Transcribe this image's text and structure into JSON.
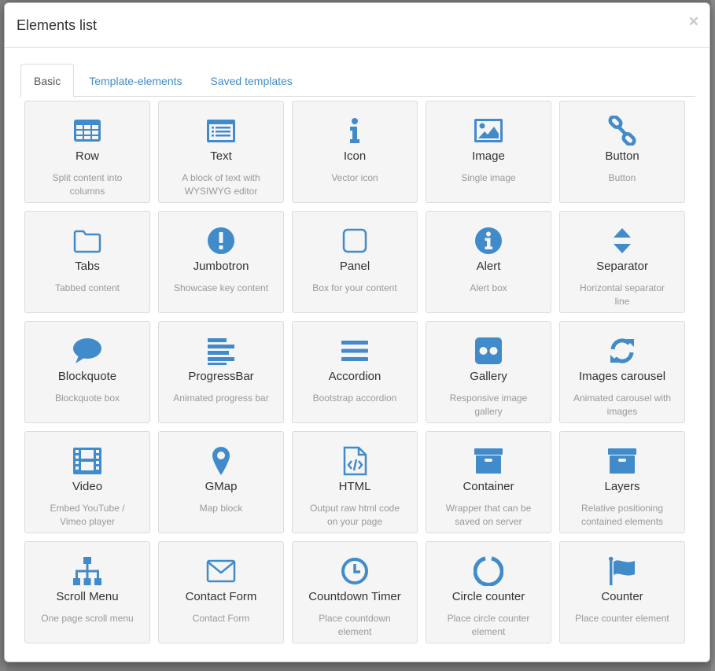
{
  "modal": {
    "title": "Elements list",
    "close_label": "×"
  },
  "tabs": [
    {
      "label": "Basic",
      "active": true
    },
    {
      "label": "Template-elements",
      "active": false
    },
    {
      "label": "Saved templates",
      "active": false
    }
  ],
  "colors": {
    "icon": "#428bca",
    "tab_link": "#428bca"
  },
  "elements": [
    {
      "title": "Row",
      "desc": "Split content into columns",
      "icon": "table-icon"
    },
    {
      "title": "Text",
      "desc": "A block of text with WYSIWYG editor",
      "icon": "text-block-icon"
    },
    {
      "title": "Icon",
      "desc": "Vector icon",
      "icon": "info-icon"
    },
    {
      "title": "Image",
      "desc": "Single image",
      "icon": "image-icon"
    },
    {
      "title": "Button",
      "desc": "Button",
      "icon": "link-icon"
    },
    {
      "title": "Tabs",
      "desc": "Tabbed content",
      "icon": "folder-icon"
    },
    {
      "title": "Jumbotron",
      "desc": "Showcase key content",
      "icon": "exclamation-circle-icon"
    },
    {
      "title": "Panel",
      "desc": "Box for your content",
      "icon": "square-icon"
    },
    {
      "title": "Alert",
      "desc": "Alert box",
      "icon": "info-circle-icon"
    },
    {
      "title": "Separator",
      "desc": "Horizontal separator line",
      "icon": "sort-icon"
    },
    {
      "title": "Blockquote",
      "desc": "Blockquote box",
      "icon": "comment-icon"
    },
    {
      "title": "ProgressBar",
      "desc": "Animated progress bar",
      "icon": "align-left-icon"
    },
    {
      "title": "Accordion",
      "desc": "Bootstrap accordion",
      "icon": "bars-icon"
    },
    {
      "title": "Gallery",
      "desc": "Responsive image gallery",
      "icon": "flickr-icon"
    },
    {
      "title": "Images carousel",
      "desc": "Animated carousel with images",
      "icon": "refresh-icon"
    },
    {
      "title": "Video",
      "desc": "Embed YouTube / Vimeo player",
      "icon": "film-icon"
    },
    {
      "title": "GMap",
      "desc": "Map block",
      "icon": "map-marker-icon"
    },
    {
      "title": "HTML",
      "desc": "Output raw html code on your page",
      "icon": "file-code-icon"
    },
    {
      "title": "Container",
      "desc": "Wrapper that can be saved on server",
      "icon": "archive-icon"
    },
    {
      "title": "Layers",
      "desc": "Relative positioning contained elements",
      "icon": "archive-icon"
    },
    {
      "title": "Scroll Menu",
      "desc": "One page scroll menu",
      "icon": "sitemap-icon"
    },
    {
      "title": "Contact Form",
      "desc": "Contact Form",
      "icon": "envelope-icon"
    },
    {
      "title": "Countdown Timer",
      "desc": "Place countdown element",
      "icon": "clock-icon"
    },
    {
      "title": "Circle counter",
      "desc": "Place circle counter element",
      "icon": "circle-notch-icon"
    },
    {
      "title": "Counter",
      "desc": "Place counter element",
      "icon": "flag-icon"
    }
  ]
}
